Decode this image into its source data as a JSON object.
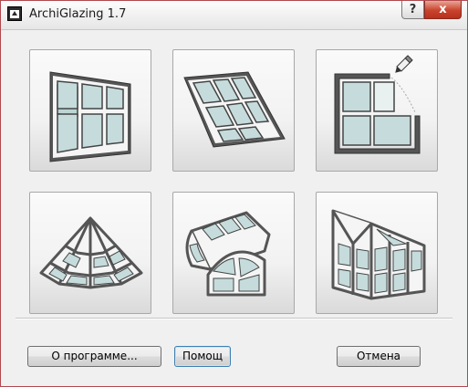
{
  "window": {
    "title": "ArchiGlazing 1.7"
  },
  "titlebar": {
    "help_label": "?",
    "close_label": "x"
  },
  "options": [
    {
      "name": "window"
    },
    {
      "name": "inclined-window"
    },
    {
      "name": "custom-window"
    },
    {
      "name": "pyramid-roof"
    },
    {
      "name": "vault-roof"
    },
    {
      "name": "conservatory"
    }
  ],
  "buttons": {
    "about_label": "О программе...",
    "help_label": "Помощ",
    "cancel_label": "Отмена"
  }
}
